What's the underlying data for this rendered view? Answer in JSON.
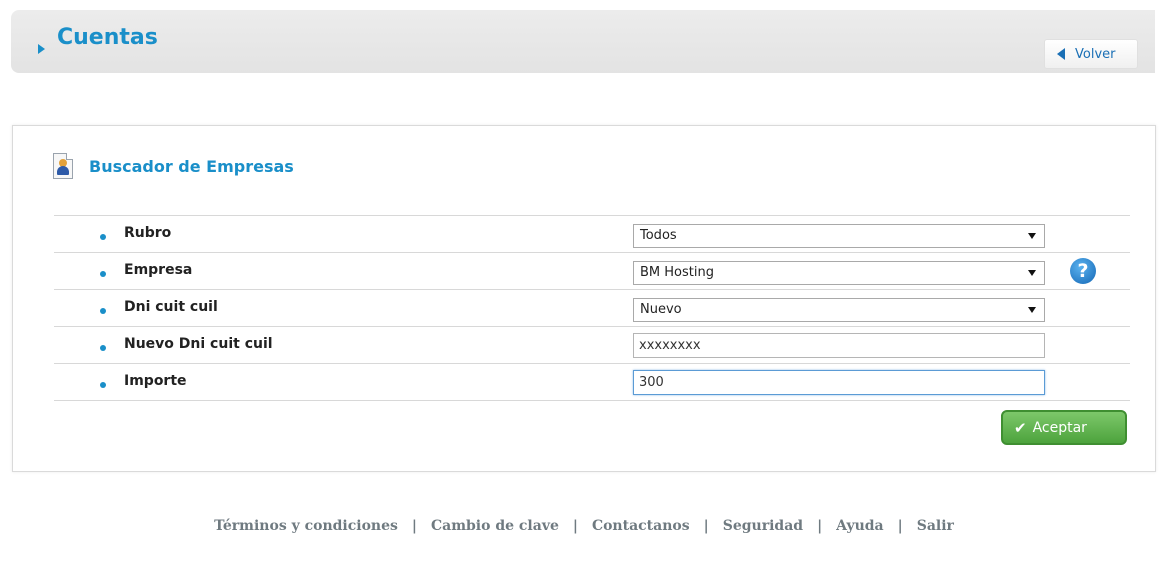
{
  "header": {
    "title": "Cuentas",
    "back_label": "Volver"
  },
  "panel": {
    "title": "Buscador de Empresas",
    "fields": [
      {
        "label": "Rubro",
        "type": "select",
        "value": "Todos"
      },
      {
        "label": "Empresa",
        "type": "select",
        "value": "BM Hosting"
      },
      {
        "label": "Dni cuit cuil",
        "type": "select",
        "value": "Nuevo"
      },
      {
        "label": "Nuevo Dni cuit cuil",
        "type": "input",
        "value": "xxxxxxxx"
      },
      {
        "label": "Importe",
        "type": "input",
        "value": "300"
      }
    ],
    "help_glyph": "?",
    "submit_label": "Aceptar"
  },
  "footer": {
    "links": [
      "Términos y condiciones",
      "Cambio de clave",
      "Contactanos",
      "Seguridad",
      "Ayuda",
      "Salir"
    ],
    "separator": "|"
  },
  "colors": {
    "accent": "#1a8fc9",
    "button_green": "#4da33d",
    "footer_text": "#6f7a80"
  }
}
